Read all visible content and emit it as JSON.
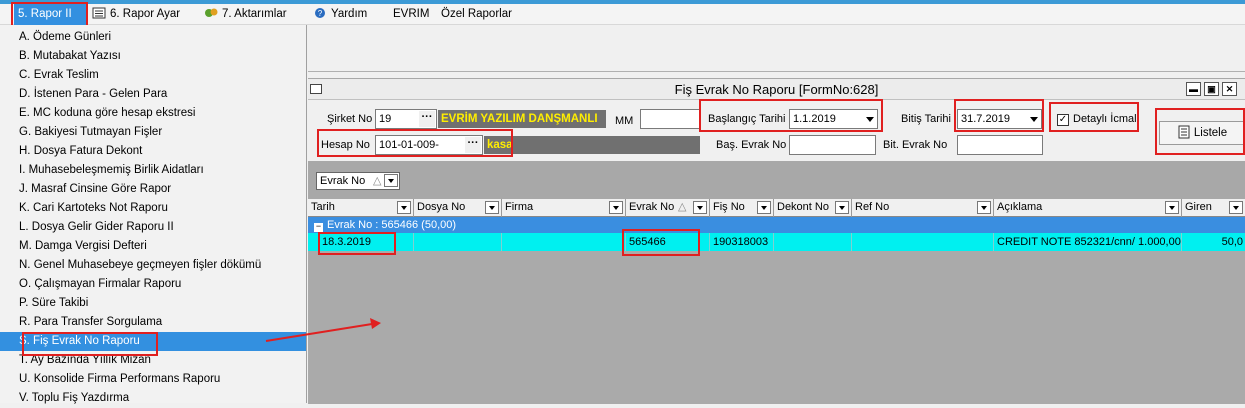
{
  "menubar": {
    "items": [
      {
        "label": "5. Rapor II",
        "icon": "report-icon"
      },
      {
        "label": "6. Rapor Ayar",
        "icon": "settings-list-icon"
      },
      {
        "label": "7. Aktarımlar",
        "icon": "transfer-icon"
      },
      {
        "label": "Yardım",
        "icon": "help-icon"
      },
      {
        "label": "EVRIM",
        "icon": ""
      },
      {
        "label": "Özel Raporlar",
        "icon": ""
      }
    ]
  },
  "dropdown": {
    "items": [
      "A. Ödeme Günleri",
      "B. Mutabakat Yazısı",
      "C. Evrak Teslim",
      "D. İstenen Para - Gelen Para",
      "E. MC koduna göre hesap ekstresi",
      "G. Bakiyesi Tutmayan Fişler",
      "H. Dosya Fatura Dekont",
      "I. Muhasebeleşmemiş Birlik Aidatları",
      "J. Masraf Cinsine Göre Rapor",
      "K. Cari Kartoteks Not Raporu",
      "L. Dosya Gelir Gider Raporu II",
      "M. Damga Vergisi Defteri",
      "N. Genel Muhasebeye geçmeyen fişler dökümü",
      "O. Çalışmayan Firmalar Raporu",
      "P. Süre Takibi",
      "R. Para Transfer Sorgulama",
      "S. Fiş Evrak No Raporu",
      "T. Ay Bazında Yıllık Mizan",
      "U. Konsolide Firma Performans Raporu",
      "V. Toplu Fiş Yazdırma"
    ],
    "selected_index": 16
  },
  "form": {
    "title": "Fiş Evrak No Raporu [FormNo:628]",
    "sirket_label": "Şirket No",
    "sirket_value": "19",
    "sirket_name": "EVRİM YAZILIM DANŞMANLI",
    "mm_label": "MM",
    "hesap_label": "Hesap No",
    "hesap_value": "101-01-009-",
    "hesap_name": "kasa",
    "baslangic_label": "Başlangıç Tarihi",
    "baslangic_value": "1.1.2019",
    "bitis_label": "Bitiş Tarihi",
    "bitis_value": "31.7.2019",
    "detayli_label": "Detaylı İcmal",
    "bas_evrak_label": "Baş. Evrak No",
    "bit_evrak_label": "Bit. Evrak No",
    "listele_label": "Listele",
    "dots": "···"
  },
  "grid": {
    "group_by": "Evrak No",
    "columns": [
      "Tarih",
      "Dosya No",
      "Firma",
      "Evrak No",
      "Fiş No",
      "Dekont No",
      "Ref No",
      "Açıklama",
      "Giren"
    ],
    "group_label": "Evrak No : 565466 (50,00)",
    "rows": [
      {
        "tarih": "18.3.2019",
        "dosya_no": "",
        "firma": "",
        "evrak_no": "565466",
        "fis_no": "190318003",
        "dekont_no": "",
        "ref_no": "",
        "aciklama": "CREDIT NOTE 852321/cnn/ 1.000,00",
        "giren": "50,0"
      }
    ]
  },
  "colors": {
    "selection_blue": "#3390e0",
    "annotation_red": "#e02020",
    "row_cyan": "#00f0f0",
    "company_yellow": "#ffee00"
  }
}
